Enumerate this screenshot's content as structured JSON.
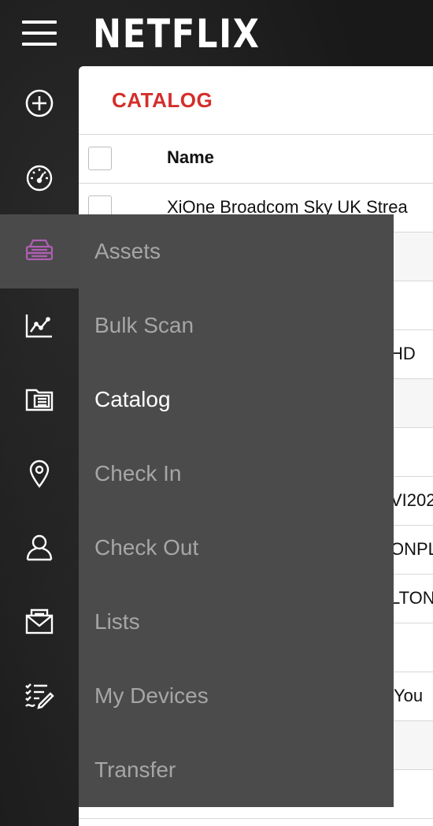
{
  "brand": {
    "logo_text": "NETFLIX"
  },
  "rail": {
    "items": [
      {
        "icon": "plus-circle-icon"
      },
      {
        "icon": "dashboard-icon"
      },
      {
        "icon": "assets-icon",
        "active": true
      },
      {
        "icon": "analytics-icon"
      },
      {
        "icon": "catalog-icon"
      },
      {
        "icon": "location-icon"
      },
      {
        "icon": "users-icon"
      },
      {
        "icon": "mail-icon"
      },
      {
        "icon": "checklist-icon"
      }
    ],
    "active_color": "#b05fb3"
  },
  "main": {
    "title": "CATALOG",
    "title_color": "#d42e2b",
    "table": {
      "header_name": "Name",
      "rows": [
        "XiOne Broadcom Sky UK Strea",
        "",
        "",
        "HD",
        "",
        "",
        "VI202",
        "ONPL",
        "LTON",
        "",
        "You",
        "",
        ""
      ]
    }
  },
  "flyout": {
    "items": [
      {
        "label": "Assets"
      },
      {
        "label": "Bulk Scan"
      },
      {
        "label": "Catalog",
        "selected": true
      },
      {
        "label": "Check In"
      },
      {
        "label": "Check Out"
      },
      {
        "label": "Lists"
      },
      {
        "label": "My Devices"
      },
      {
        "label": "Transfer"
      }
    ]
  }
}
